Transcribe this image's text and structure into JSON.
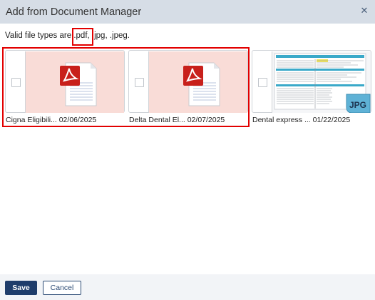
{
  "dialog": {
    "title": "Add from Document Manager",
    "close_icon": "close-icon"
  },
  "file_types": {
    "prefix": "Valid file types are",
    "pdf": ".pdf",
    "rest": ", .jpg, .jpeg."
  },
  "documents": [
    {
      "name": "Cigna Eligibili...",
      "date": "02/06/2025",
      "type_icon": "pdf-icon"
    },
    {
      "name": "Delta Dental El...",
      "date": "02/07/2025",
      "type_icon": "pdf-icon"
    },
    {
      "name": "Dental express ...",
      "date": "01/22/2025",
      "type_icon": "jpg-icon",
      "badge": "JPG"
    }
  ],
  "footer": {
    "save_label": "Save",
    "cancel_label": "Cancel"
  },
  "colors": {
    "header_bg": "#d6dde6",
    "highlight": "#e20000",
    "pdf_red": "#c8201b",
    "primary": "#1f3d6b",
    "jpg_badge": "#5fb2d6"
  }
}
